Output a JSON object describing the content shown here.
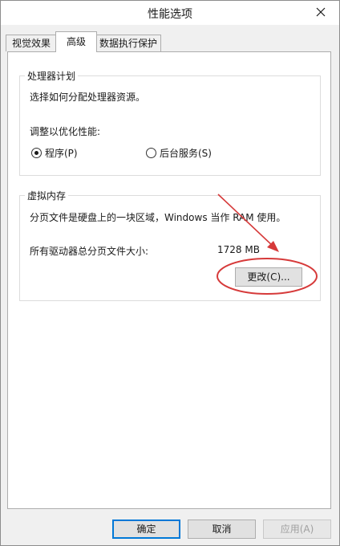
{
  "window": {
    "title": "性能选项"
  },
  "tabs": [
    {
      "label": "视觉效果"
    },
    {
      "label": "高级"
    },
    {
      "label": "数据执行保护"
    }
  ],
  "processor": {
    "group_title": "处理器计划",
    "description": "选择如何分配处理器资源。",
    "optimize_label": "调整以优化性能:",
    "option_programs": "程序(P)",
    "option_services": "后台服务(S)",
    "selected": "程序(P)"
  },
  "virtual_memory": {
    "group_title": "虚拟内存",
    "description": "分页文件是硬盘上的一块区域，Windows 当作 RAM 使用。",
    "total_label": "所有驱动器总分页文件大小:",
    "total_value": "1728 MB",
    "change_button": "更改(C)..."
  },
  "footer": {
    "ok": "确定",
    "cancel": "取消",
    "apply": "应用(A)"
  },
  "annotation_color": "#d63a3a"
}
